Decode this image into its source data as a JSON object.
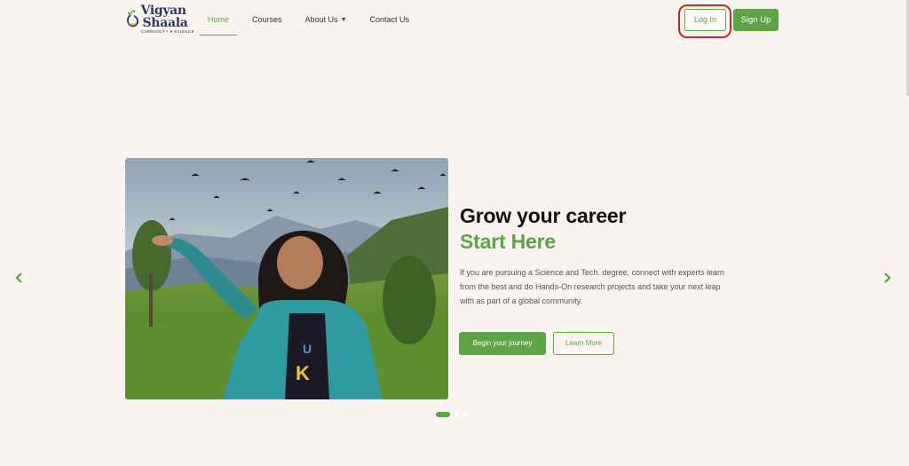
{
  "header": {
    "logo": {
      "line1": "Vigyan",
      "line2": "Shaala",
      "tagline": "COMMUNITY ● SCIENCE"
    },
    "nav": [
      {
        "label": "Home",
        "active": true
      },
      {
        "label": "Courses"
      },
      {
        "label": "About Us",
        "has_dropdown": true
      },
      {
        "label": "Contact Us"
      }
    ],
    "login_label": "Log In",
    "signup_label": "Sign Up"
  },
  "hero": {
    "headline_line1": "Grow your career",
    "headline_line2": "Start Here",
    "description": "If you are pursuing a Science and Tech. degree, connect with experts learn from the best and do Hands-On research projects and take your next leap with as part of a global community.",
    "primary_button": "Begin your journey",
    "secondary_button": "Learn More",
    "prev_icon": "chevron-left-icon",
    "next_icon": "chevron-right-icon",
    "slide_count": 3,
    "active_slide": 1
  },
  "colors": {
    "accent": "#5ea446",
    "background": "#f9f4ef",
    "highlight": "#d0242b"
  }
}
